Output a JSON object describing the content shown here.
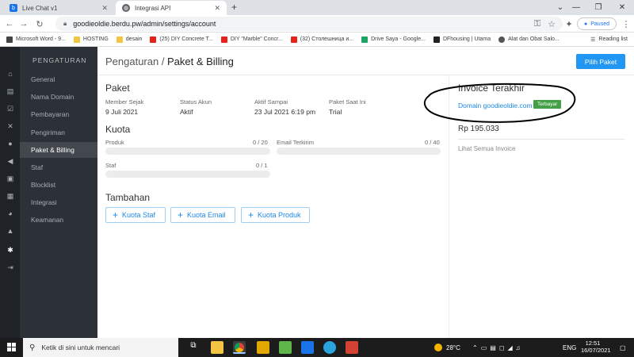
{
  "browser": {
    "tabs": [
      {
        "label": "Live Chat v1",
        "icon": "livechat-favicon"
      },
      {
        "label": "Integrasi API",
        "icon": "globe-favicon"
      }
    ],
    "new_tab": "+",
    "url": "goodieoldie.berdu.pw/admin/settings/account",
    "profile_status": "Paused",
    "bookmarks": [
      {
        "label": "Microsoft Word - 9...",
        "color": "#444444"
      },
      {
        "label": "HOSTING",
        "color": "#f4c542"
      },
      {
        "label": "desain",
        "color": "#f4c542"
      },
      {
        "label": "(25) DIY Concrete T...",
        "color": "#e62117"
      },
      {
        "label": "DIY \"Marble\" Concr...",
        "color": "#e62117"
      },
      {
        "label": "(32) Столешница и...",
        "color": "#e62117"
      },
      {
        "label": "Drive Saya - Google...",
        "color": "#1fa463"
      },
      {
        "label": "DFhousing | Utama",
        "color": "#222222"
      },
      {
        "label": "Alat dan Obat Salo...",
        "color": "#555555"
      }
    ],
    "reading_list": "Reading list"
  },
  "sidebar": {
    "heading": "PENGATURAN",
    "items": [
      {
        "label": "General"
      },
      {
        "label": "Nama Domain"
      },
      {
        "label": "Pembayaran"
      },
      {
        "label": "Pengiriman"
      },
      {
        "label": "Paket & Billing",
        "active": true
      },
      {
        "label": "Staf"
      },
      {
        "label": "Blocklist"
      },
      {
        "label": "Integrasi"
      },
      {
        "label": "Keamanan"
      }
    ]
  },
  "header": {
    "crumb_parent": "Pengaturan /",
    "crumb_current": "Paket & Billing",
    "primary_button": "Pilih Paket"
  },
  "paket": {
    "title": "Paket",
    "fields": [
      {
        "label": "Member Sejak",
        "value": "9 Juli 2021"
      },
      {
        "label": "Status Akun",
        "value": "Aktif"
      },
      {
        "label": "Aktif Sampai",
        "value": "23 Jul 2021 6:19 pm"
      },
      {
        "label": "Paket Saat Ini",
        "value": "Trial"
      }
    ]
  },
  "kuota": {
    "title": "Kuota",
    "items": [
      {
        "label": "Produk",
        "count": "0 / 20",
        "fraction": 0
      },
      {
        "label": "Email Terkirim",
        "count": "0 / 40",
        "fraction": 0
      },
      {
        "label": "Staf",
        "count": "0 / 1",
        "fraction": 0
      }
    ]
  },
  "tambahan": {
    "title": "Tambahan",
    "buttons": [
      "Kuota Staf",
      "Kuota Email",
      "Kuota Produk"
    ]
  },
  "invoice": {
    "title": "Invoice Terakhir",
    "domain": "Domain goodieoldie.com",
    "status": "Terbayar",
    "amount": "Rp 195.033",
    "see_all": "Lihat Semua Invoice"
  },
  "taskbar": {
    "search_placeholder": "Ketik di sini untuk mencari",
    "temperature": "28°C",
    "language": "ENG",
    "time": "12:51",
    "date": "16/07/2021"
  },
  "colors": {
    "primary": "#2196f3",
    "success": "#43a047",
    "sidebar_bg": "#2b3136",
    "rail_bg": "#1f2328"
  }
}
